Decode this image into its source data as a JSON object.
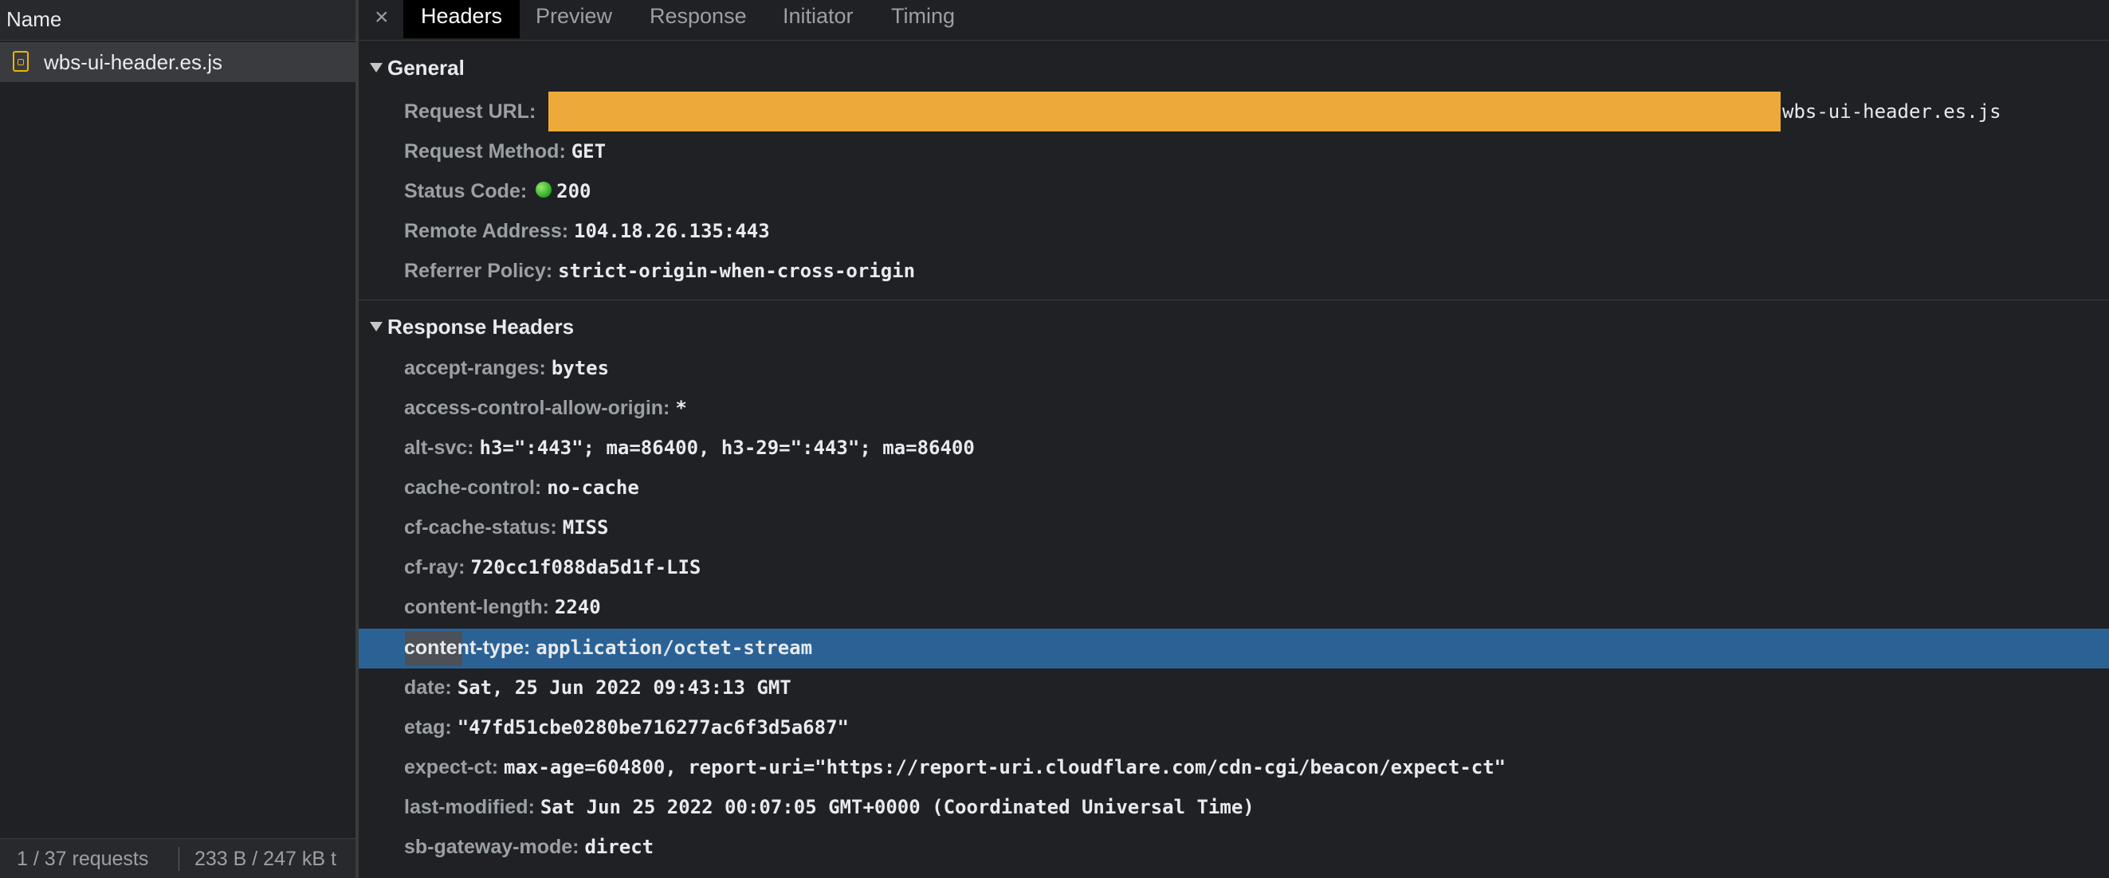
{
  "left": {
    "column_header": "Name",
    "file": {
      "name": "wbs-ui-header.es.js",
      "icon": "js-file-icon"
    },
    "footer": {
      "requests": "1 / 37 requests",
      "transferred": "233 B / 247 kB t"
    }
  },
  "tabs": {
    "close": "×",
    "items": [
      "Headers",
      "Preview",
      "Response",
      "Initiator",
      "Timing"
    ],
    "active": "Headers"
  },
  "general": {
    "title": "General",
    "request_url": {
      "key": "Request URL:",
      "value_tail": "wbs-ui-header.es.js"
    },
    "request_method": {
      "key": "Request Method:",
      "value": "GET"
    },
    "status_code": {
      "key": "Status Code:",
      "value": "200"
    },
    "remote_address": {
      "key": "Remote Address:",
      "value": "104.18.26.135:443"
    },
    "referrer_policy": {
      "key": "Referrer Policy:",
      "value": "strict-origin-when-cross-origin"
    }
  },
  "response_headers": {
    "title": "Response Headers",
    "rows": [
      {
        "key": "accept-ranges:",
        "value": "bytes"
      },
      {
        "key": "access-control-allow-origin:",
        "value": "*"
      },
      {
        "key": "alt-svc:",
        "value": "h3=\":443\"; ma=86400, h3-29=\":443\"; ma=86400"
      },
      {
        "key": "cache-control:",
        "value": "no-cache"
      },
      {
        "key": "cf-cache-status:",
        "value": "MISS"
      },
      {
        "key": "cf-ray:",
        "value": "720cc1f088da5d1f-LIS"
      },
      {
        "key": "content-length:",
        "value": "2240"
      },
      {
        "key": "content-type:",
        "value": "application/octet-stream"
      },
      {
        "key": "date:",
        "value": "Sat, 25 Jun 2022 09:43:13 GMT"
      },
      {
        "key": "etag:",
        "value": "\"47fd51cbe0280be716277ac6f3d5a687\""
      },
      {
        "key": "expect-ct:",
        "value": "max-age=604800, report-uri=\"https://report-uri.cloudflare.com/cdn-cgi/beacon/expect-ct\""
      },
      {
        "key": "last-modified:",
        "value": "Sat Jun 25 2022 00:07:05 GMT+0000 (Coordinated Universal Time)"
      },
      {
        "key": "sb-gateway-mode:",
        "value": "direct"
      }
    ]
  },
  "colors": {
    "redaction": "#edaa3a",
    "selection": "#2b6296",
    "status_ok": "#26a826"
  }
}
